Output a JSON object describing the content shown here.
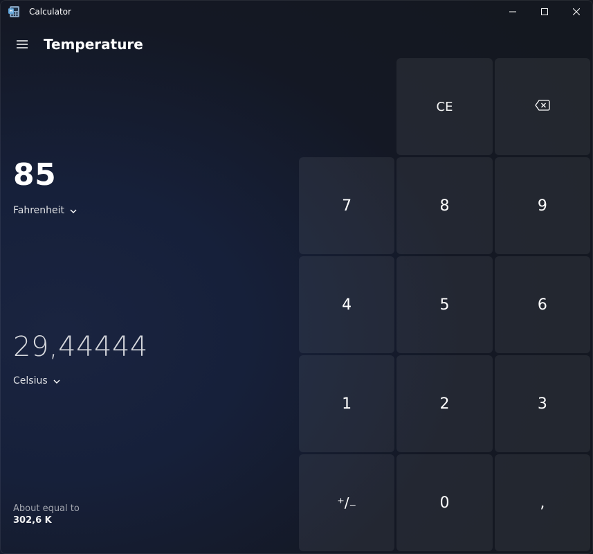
{
  "window": {
    "title": "Calculator"
  },
  "header": {
    "mode": "Temperature"
  },
  "conversion": {
    "from": {
      "value": "85",
      "unit_label": "Fahrenheit"
    },
    "to": {
      "value": "29,44444",
      "unit_label": "Celsius"
    },
    "about": {
      "label": "About equal to",
      "value": "302,6 K"
    }
  },
  "keypad": {
    "ce": "CE",
    "n7": "7",
    "n8": "8",
    "n9": "9",
    "n4": "4",
    "n5": "5",
    "n6": "6",
    "n1": "1",
    "n2": "2",
    "n3": "3",
    "plusminus": "⁺/₋",
    "n0": "0",
    "decimal": ","
  }
}
